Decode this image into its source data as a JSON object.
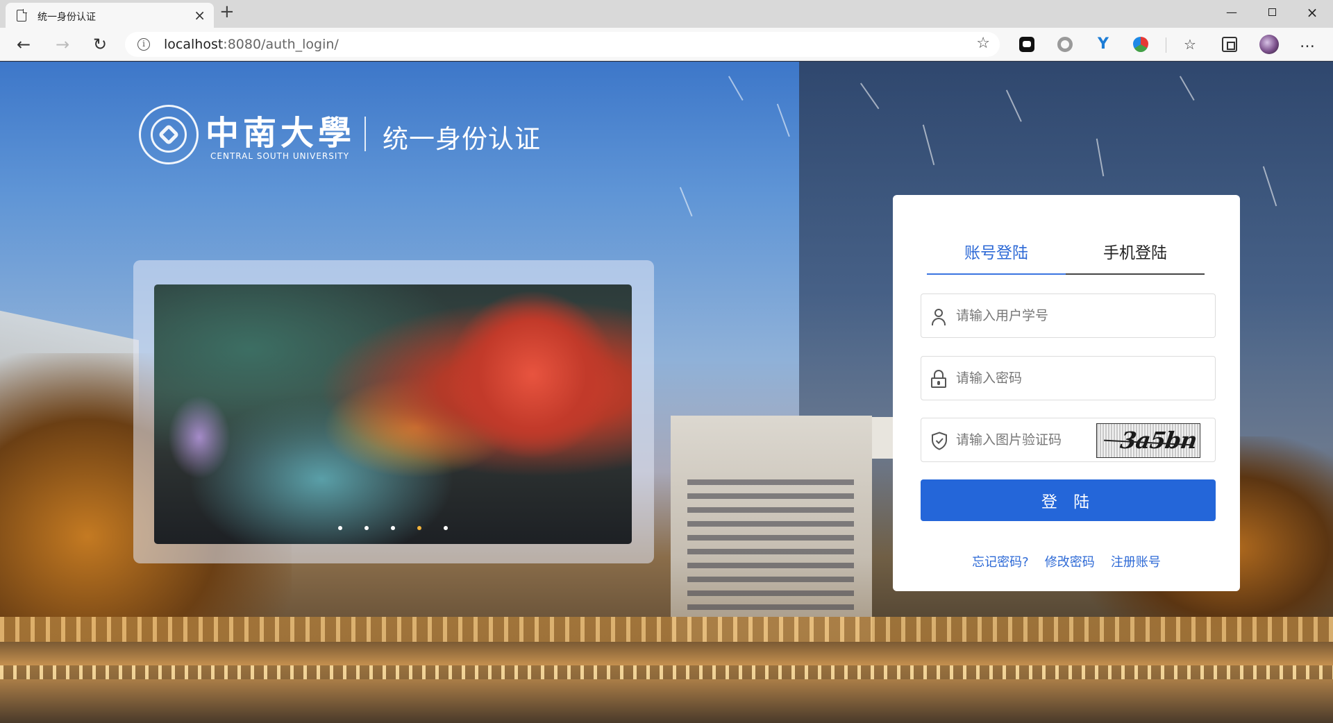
{
  "browser": {
    "tab_title": "统一身份认证",
    "url_host": "localhost",
    "url_rest": ":8080/auth_login/"
  },
  "logo": {
    "name_cn": "中南大學",
    "name_en": "CENTRAL SOUTH UNIVERSITY",
    "system_title": "统一身份认证"
  },
  "carousel": {
    "dot_count": 5,
    "active_index": 3
  },
  "login": {
    "tabs": [
      {
        "label": "账号登陆",
        "active": true
      },
      {
        "label": "手机登陆",
        "active": false
      }
    ],
    "username_placeholder": "请输入用户学号",
    "password_placeholder": "请输入密码",
    "captcha_placeholder": "请输入图片验证码",
    "captcha_text": "3a5bn",
    "submit_label": "登 陆",
    "links": {
      "forgot": "忘记密码?",
      "change": "修改密码",
      "register": "注册账号"
    }
  },
  "colors": {
    "accent": "#2466d9",
    "active_tab_text": "#2e6ad6",
    "carousel_active_dot": "#f2b43c"
  }
}
